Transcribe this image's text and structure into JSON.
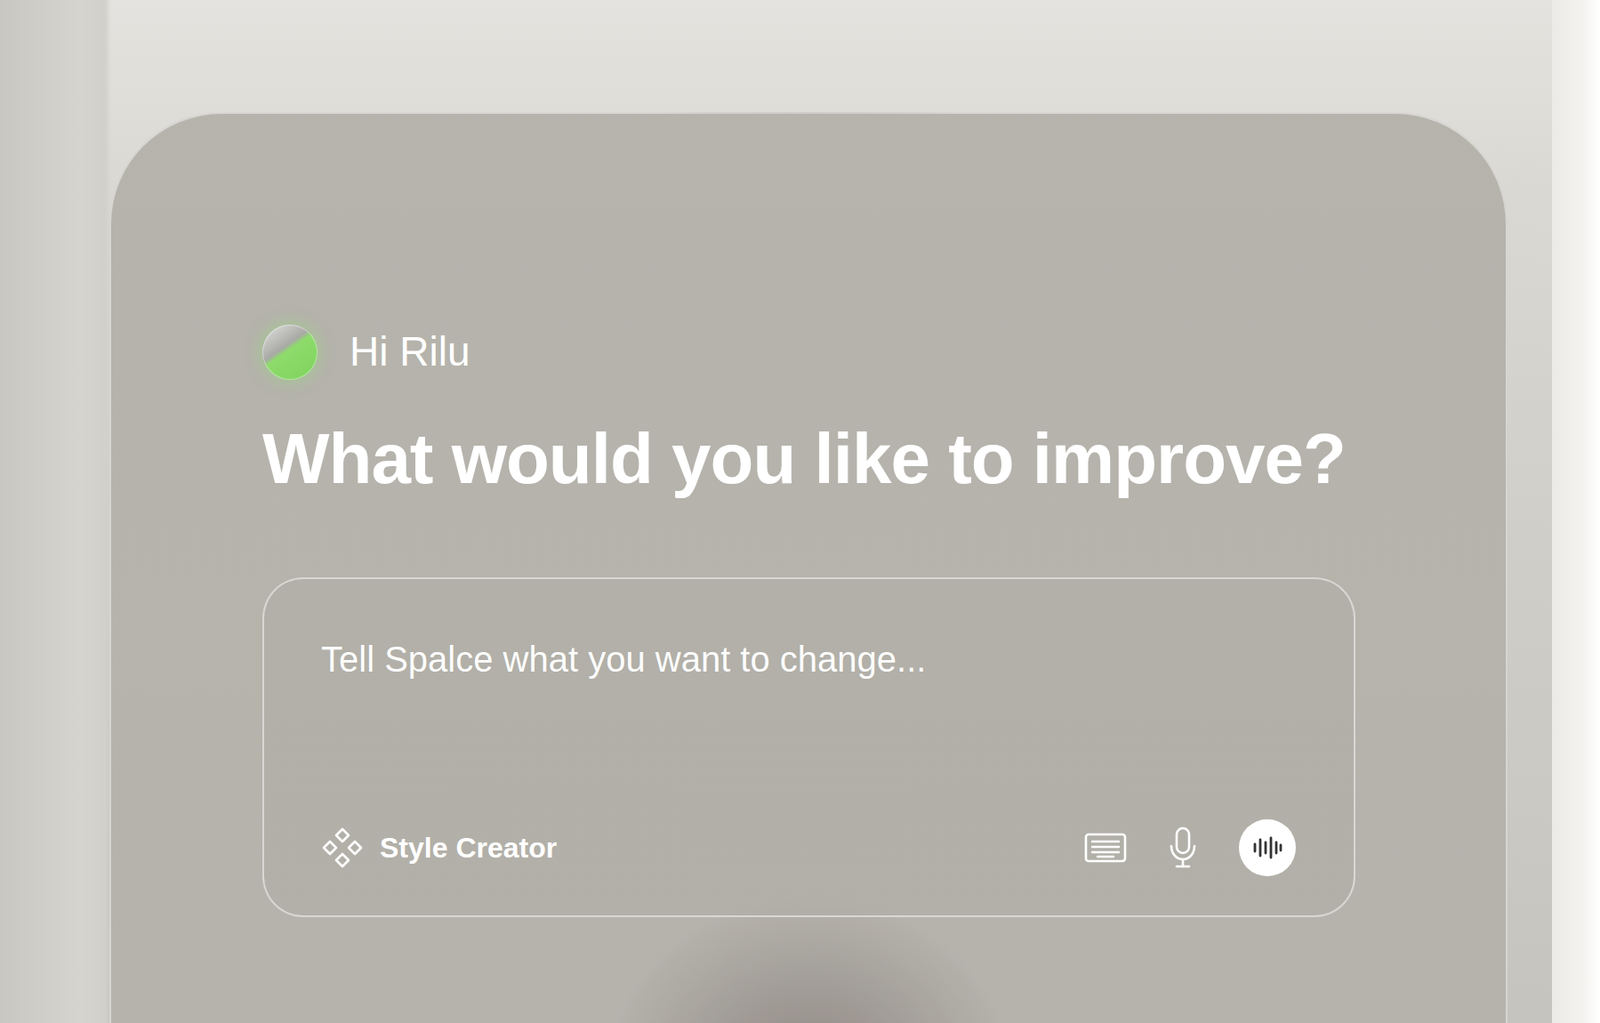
{
  "greeting": "Hi Rilu",
  "headline": "What would you like to improve?",
  "prompt": {
    "placeholder": "Tell Spalce what you want to change..."
  },
  "style_creator": {
    "label": "Style Creator"
  }
}
